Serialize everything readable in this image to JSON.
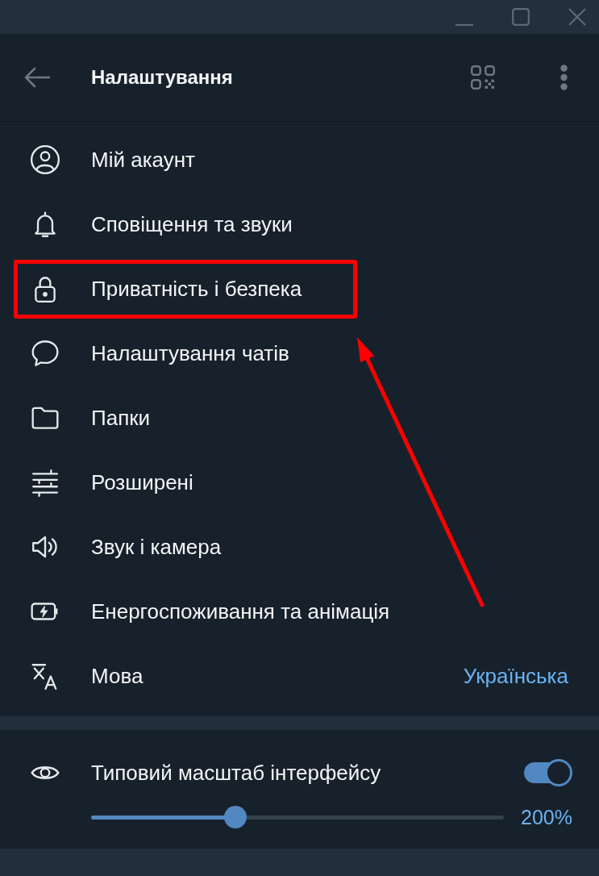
{
  "header": {
    "title": "Налаштування"
  },
  "menu": {
    "items": [
      {
        "kind": "account",
        "label": "Мій акаунт",
        "highlighted": false
      },
      {
        "kind": "notifications",
        "label": "Сповіщення та звуки",
        "highlighted": false
      },
      {
        "kind": "privacy",
        "label": "Приватність і безпека",
        "highlighted": true
      },
      {
        "kind": "chats",
        "label": "Налаштування чатів",
        "highlighted": false
      },
      {
        "kind": "folders",
        "label": "Папки",
        "highlighted": false
      },
      {
        "kind": "advanced",
        "label": "Розширені",
        "highlighted": false
      },
      {
        "kind": "audio",
        "label": "Звук і камера",
        "highlighted": false
      },
      {
        "kind": "power",
        "label": "Енергоспоживання та анімація",
        "highlighted": false
      },
      {
        "kind": "language",
        "label": "Мова",
        "value": "Українська",
        "highlighted": false
      }
    ]
  },
  "scale_setting": {
    "label": "Типовий масштаб інтерфейсу",
    "on": true,
    "level": 0.35,
    "reading": "200%"
  },
  "pointer_arrow": true
}
